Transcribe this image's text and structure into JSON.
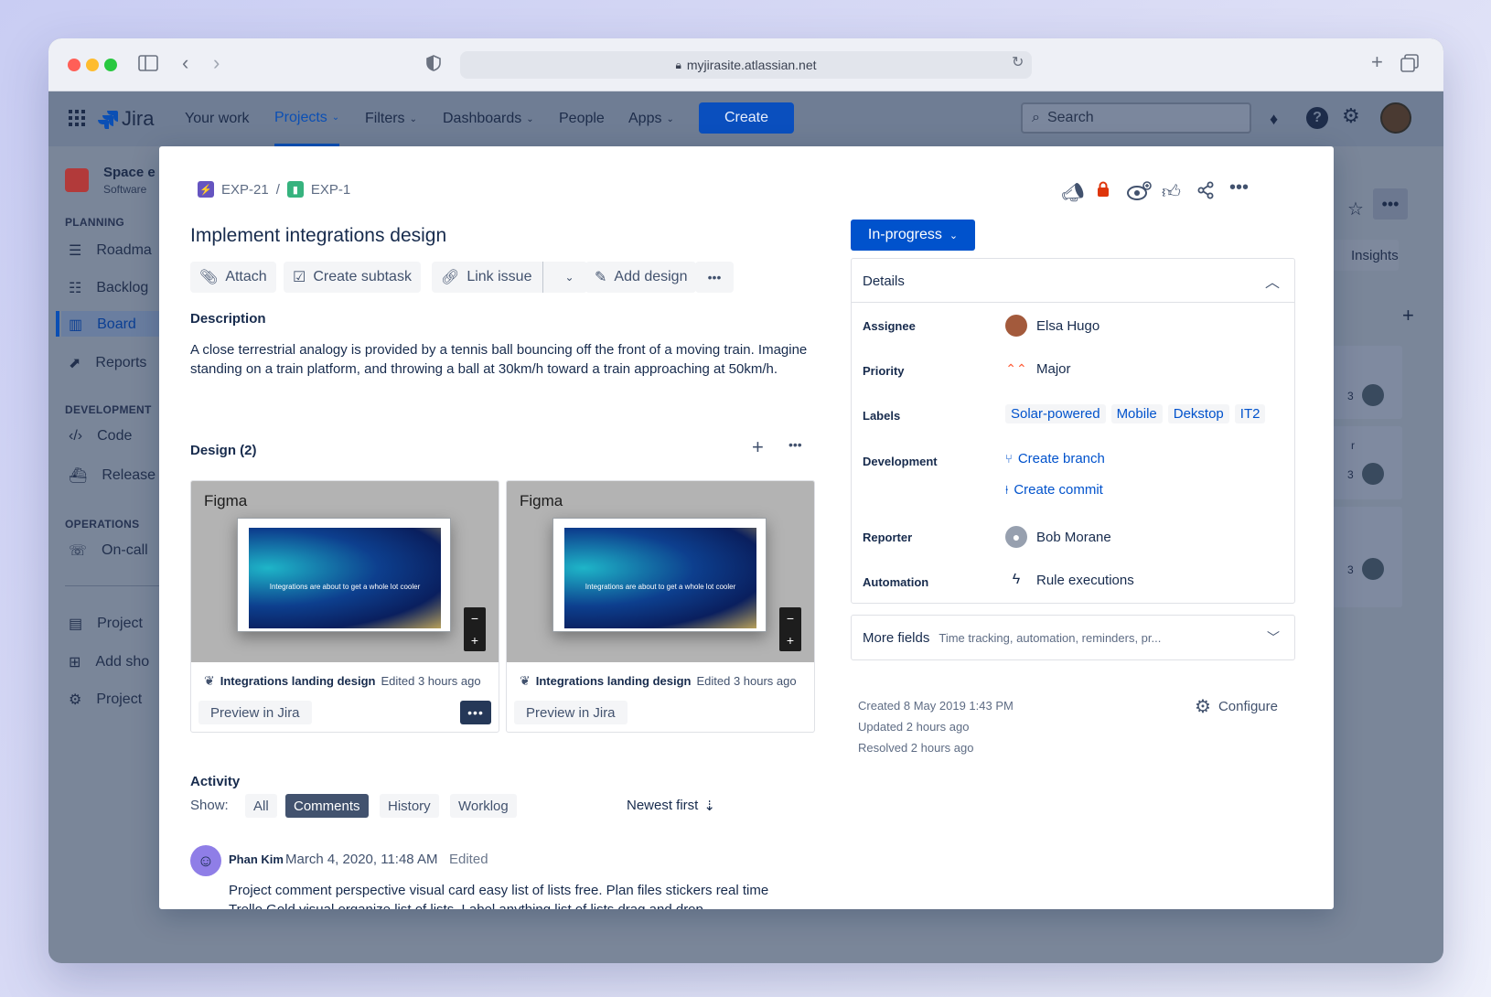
{
  "browser": {
    "url": "myjirasite.atlassian.net"
  },
  "nav": {
    "logo": "Jira",
    "items": [
      "Your work",
      "Projects",
      "Filters",
      "Dashboards",
      "People",
      "Apps"
    ],
    "create": "Create",
    "search_placeholder": "Search"
  },
  "sidebar": {
    "project_name": "Space e",
    "project_type": "Software",
    "sections": [
      "PLANNING",
      "DEVELOPMENT",
      "OPERATIONS"
    ],
    "items": [
      "Roadma",
      "Backlog",
      "Board",
      "Reports",
      "Code",
      "Release",
      "On-call",
      "Project",
      "Add sho",
      "Project"
    ]
  },
  "background": {
    "insights": "Insights",
    "badge": "3",
    "fragment": "r"
  },
  "issue": {
    "parent_key": "EXP-21",
    "key": "EXP-1",
    "title": "Implement integrations design",
    "toolbar": {
      "attach": "Attach",
      "subtask": "Create subtask",
      "link": "Link issue",
      "design": "Add design"
    },
    "description_heading": "Description",
    "description": "A close terrestrial analogy is provided by a tennis ball bouncing off the front of a moving train. Imagine standing on a train platform, and throwing a ball at 30km/h toward a train approaching at 50km/h.",
    "design_heading": "Design (2)",
    "designs": [
      {
        "source": "Figma",
        "preview_text": "Integrations are about to get a whole lot cooler",
        "name": "Integrations landing design",
        "edited": "Edited 3 hours ago",
        "preview": "Preview in Jira"
      },
      {
        "source": "Figma",
        "preview_text": "Integrations are about to get a whole lot cooler",
        "name": "Integrations landing design",
        "edited": "Edited 3 hours ago",
        "preview": "Preview in Jira"
      }
    ],
    "activity": {
      "heading": "Activity",
      "show": "Show:",
      "tabs": [
        "All",
        "Comments",
        "History",
        "Worklog"
      ],
      "selected_tab": "Comments",
      "sort": "Newest first",
      "comment": {
        "author": "Phan Kim",
        "date": "March 4, 2020, 11:48 AM",
        "edited": "Edited",
        "text": "Project comment perspective visual card easy list of lists free. Plan files stickers real time Trello Gold visual organize list of lists. Label anything list of lists drag and drop"
      }
    },
    "status": "In-progress",
    "details": {
      "heading": "Details",
      "assignee_label": "Assignee",
      "assignee": "Elsa Hugo",
      "priority_label": "Priority",
      "priority": "Major",
      "labels_label": "Labels",
      "labels": [
        "Solar-powered",
        "Mobile",
        "Dekstop",
        "IT2"
      ],
      "development_label": "Development",
      "create_branch": "Create branch",
      "create_commit": "Create commit",
      "reporter_label": "Reporter",
      "reporter": "Bob Morane",
      "automation_label": "Automation",
      "automation": "Rule executions"
    },
    "more_fields": {
      "label": "More fields",
      "hint": "Time tracking, automation, reminders, pr..."
    },
    "created": "Created 8 May 2019 1:43 PM",
    "updated": "Updated 2 hours ago",
    "resolved": "Resolved 2 hours ago",
    "configure": "Configure"
  },
  "colors": {
    "primary": "#0052CC",
    "priority_major": "#FF5630",
    "lock": "#DE350B"
  }
}
